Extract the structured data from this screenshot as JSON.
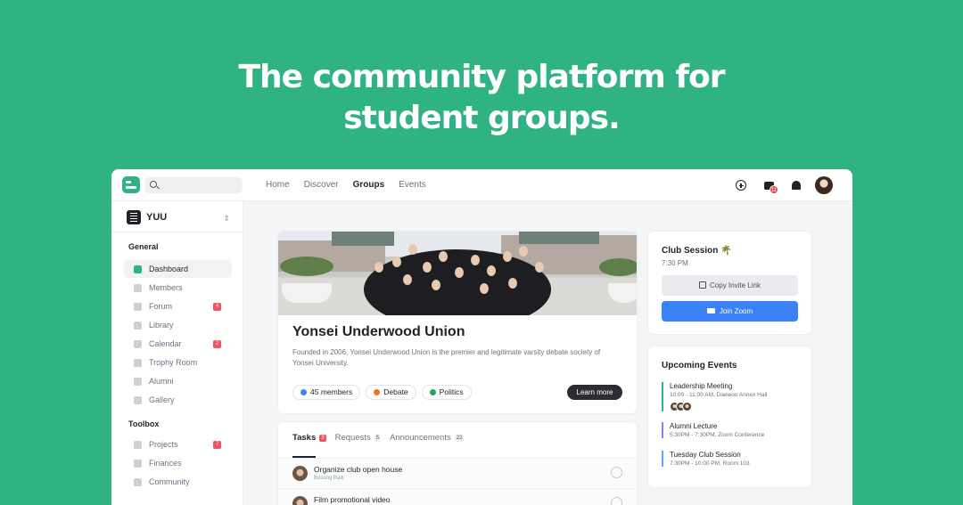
{
  "headline": {
    "line1": "The community platform for",
    "line2": "student groups."
  },
  "topbar": {
    "nav": [
      "Home",
      "Discover",
      "Groups",
      "Events"
    ],
    "active_nav": "Groups",
    "chat_badge": "11"
  },
  "sidebar": {
    "org_name": "YUU",
    "sections": [
      {
        "title": "General",
        "items": [
          {
            "label": "Dashboard",
            "badge": ""
          },
          {
            "label": "Members",
            "badge": ""
          },
          {
            "label": "Forum",
            "badge": "4"
          },
          {
            "label": "Library",
            "badge": ""
          },
          {
            "label": "Calendar",
            "badge": "2"
          },
          {
            "label": "Trophy Room",
            "badge": ""
          },
          {
            "label": "Alumni",
            "badge": ""
          },
          {
            "label": "Gallery",
            "badge": ""
          }
        ]
      },
      {
        "title": "Toolbox",
        "items": [
          {
            "label": "Projects",
            "badge": "7"
          },
          {
            "label": "Finances",
            "badge": ""
          },
          {
            "label": "Community",
            "badge": ""
          }
        ]
      }
    ]
  },
  "group": {
    "title": "Yonsei Underwood Union",
    "description": "Founded in 2006, Yonsei Underwood Union is the premier and legitimate varsity debate society of Yonsei University.",
    "tags": [
      {
        "label": "45 members",
        "color": "#3b82f6"
      },
      {
        "label": "Debate",
        "color": "#f97316"
      },
      {
        "label": "Politics",
        "color": "#22a559"
      }
    ],
    "learn_more": "Learn more"
  },
  "tasks": {
    "tabs": [
      {
        "label": "Tasks",
        "count": "3"
      },
      {
        "label": "Requests",
        "count": "5"
      },
      {
        "label": "Announcements",
        "count": "22"
      }
    ],
    "rows": [
      {
        "title": "Organize club open house",
        "assignee": "Bosung Baik"
      },
      {
        "title": "Film promotional video",
        "assignee": ""
      }
    ]
  },
  "session": {
    "title": "Club Session 🌴",
    "time": "7:30 PM",
    "copy_label": "Copy Invite Link",
    "zoom_label": "Join Zoom"
  },
  "events": {
    "title": "Upcoming Events",
    "items": [
      {
        "name": "Leadership Meeting",
        "time": "10:00 - 11:00 AM, Daewoo Annex Hall",
        "color": "#30b383"
      },
      {
        "name": "Alumni Lecture",
        "time": "5:30PM - 7:30PM, Zoom Conference",
        "color": "#8b7cf6"
      },
      {
        "name": "Tuesday Club Session",
        "time": "7:30PM - 10:00 PM, Room 103",
        "color": "#60a5fa"
      }
    ]
  }
}
